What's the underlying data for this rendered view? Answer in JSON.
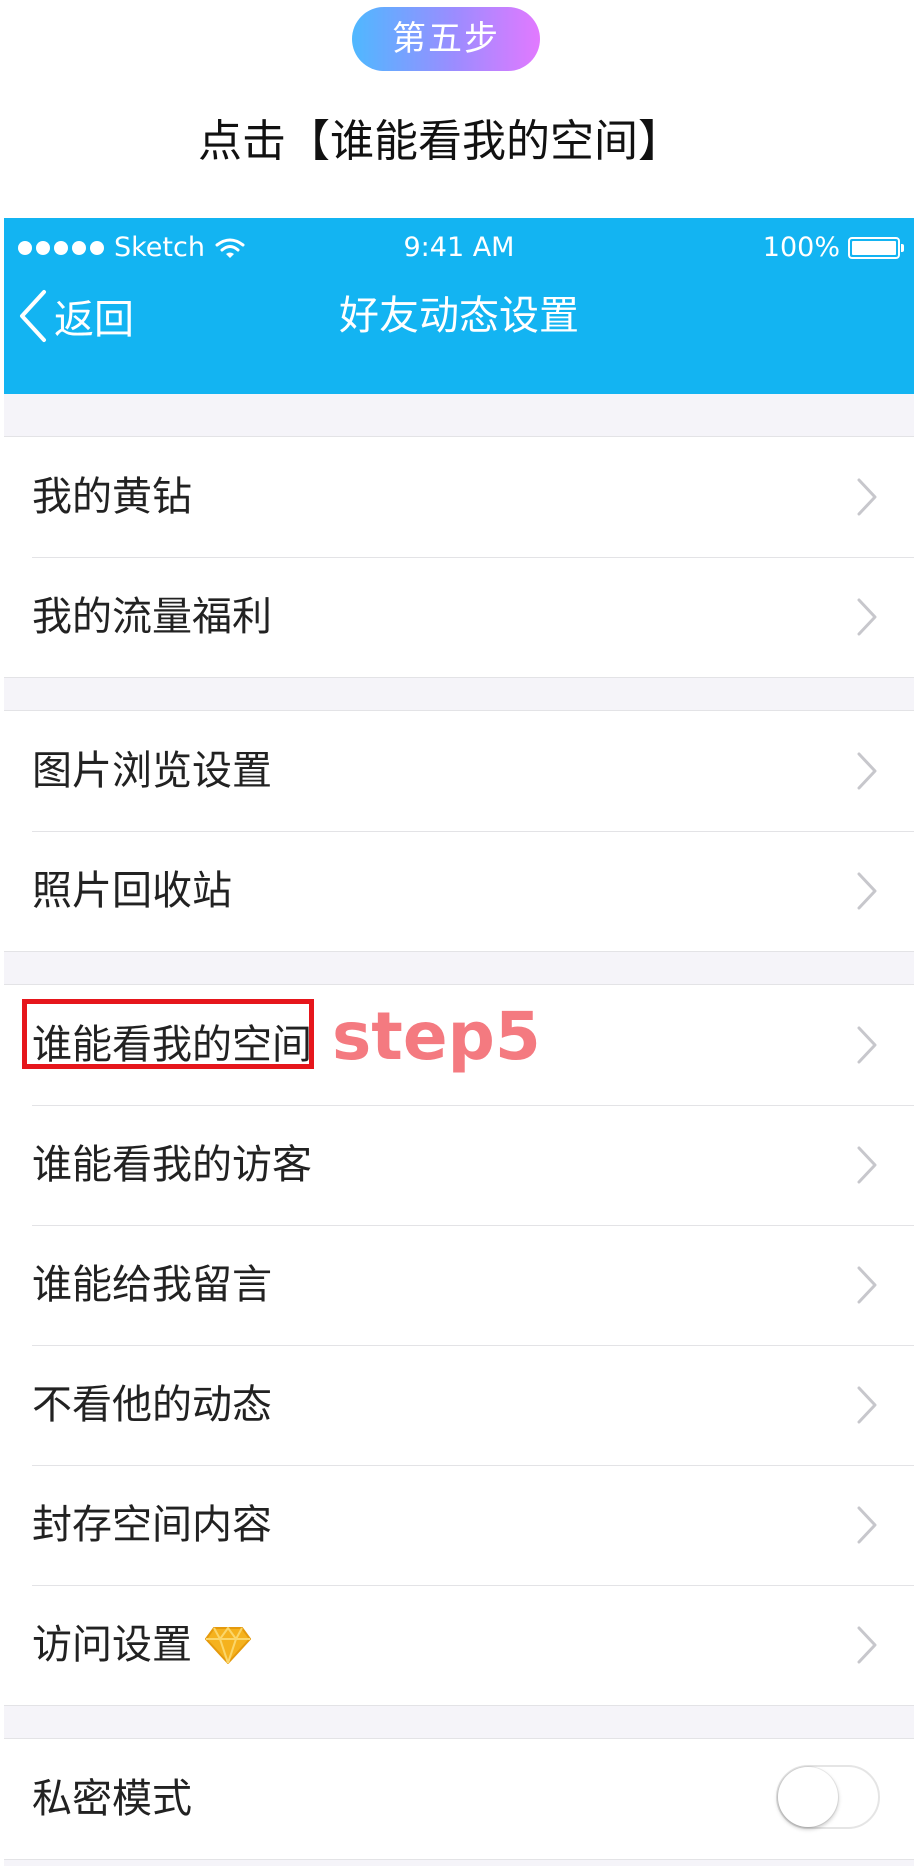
{
  "tutorial": {
    "step_badge": "第五步",
    "instruction": "点击【谁能看我的空间】",
    "annotation": "step5"
  },
  "status_bar": {
    "carrier": "Sketch",
    "time": "9:41 AM",
    "battery": "100%"
  },
  "nav": {
    "back_label": "返回",
    "title": "好友动态设置"
  },
  "groups": [
    {
      "items": [
        {
          "label": "我的黄钻"
        },
        {
          "label": "我的流量福利"
        }
      ]
    },
    {
      "items": [
        {
          "label": "图片浏览设置"
        },
        {
          "label": "照片回收站"
        }
      ]
    },
    {
      "items": [
        {
          "label": "谁能看我的空间"
        },
        {
          "label": "谁能看我的访客"
        },
        {
          "label": "谁能给我留言"
        },
        {
          "label": "不看他的动态"
        },
        {
          "label": "封存空间内容"
        },
        {
          "label": "访问设置"
        }
      ]
    },
    {
      "items": [
        {
          "label": "私密模式",
          "toggle_on": false
        }
      ]
    }
  ],
  "colors": {
    "nav_background": "#13b4f2",
    "highlight": "#e6161c",
    "annotation": "#f47a80",
    "diamond": "#f5b21e"
  }
}
